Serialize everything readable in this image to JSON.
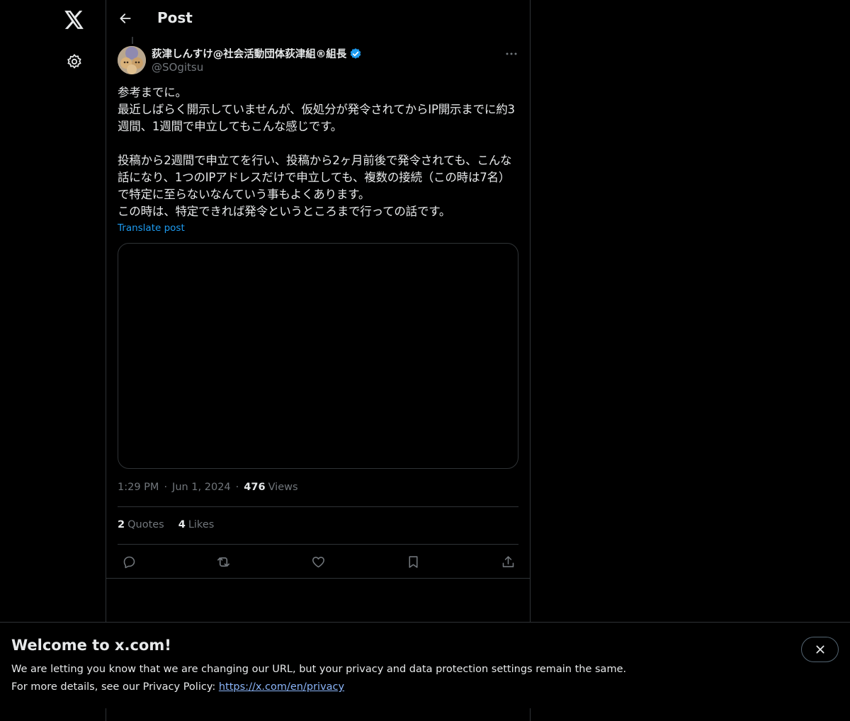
{
  "nav": {
    "logo_icon": "x-logo-icon",
    "settings_icon": "gear-icon"
  },
  "header": {
    "back_icon": "arrow-left-icon",
    "title": "Post"
  },
  "post": {
    "author": {
      "display_name": "荻津しんすけ@社会活動団体荻津組®組長",
      "handle": "@SOgitsu",
      "verified_icon": "verified-badge-icon"
    },
    "more_icon": "more-horizontal-icon",
    "text": "参考までに。\n最近しばらく開示していませんが、仮処分が発令されてからIP開示までに約3週間、1週間で申立してもこんな感じです。\n\n投稿から2週間で申立てを行い、投稿から2ヶ月前後で発令されても、こんな話になり、1つのIPアドレスだけで申立しても、複数の接続（この時は7名）で特定に至らないなんていう事もよくあります。\nこの時は、特定できれば発令というところまで行っての話です。",
    "translate_label": "Translate post",
    "time": "1:29 PM",
    "date": "Jun 1, 2024",
    "views_count": "476",
    "views_label": "Views",
    "quotes_count": "2",
    "quotes_label": "Quotes",
    "likes_count": "4",
    "likes_label": "Likes",
    "actions": [
      "reply-icon",
      "repost-icon",
      "like-icon",
      "bookmark-icon",
      "share-icon"
    ]
  },
  "banner": {
    "title": "Welcome to x.com!",
    "line1": "We are letting you know that we are changing our URL, but your privacy and data protection settings remain the same.",
    "line2_prefix": "For more details, see our Privacy Policy: ",
    "link": "https://x.com/en/privacy",
    "close_icon": "close-icon"
  },
  "colors": {
    "background": "#000000",
    "text": "#e7e9ea",
    "muted": "#71767b",
    "accent": "#1d9bf0",
    "border": "#2f3336"
  }
}
